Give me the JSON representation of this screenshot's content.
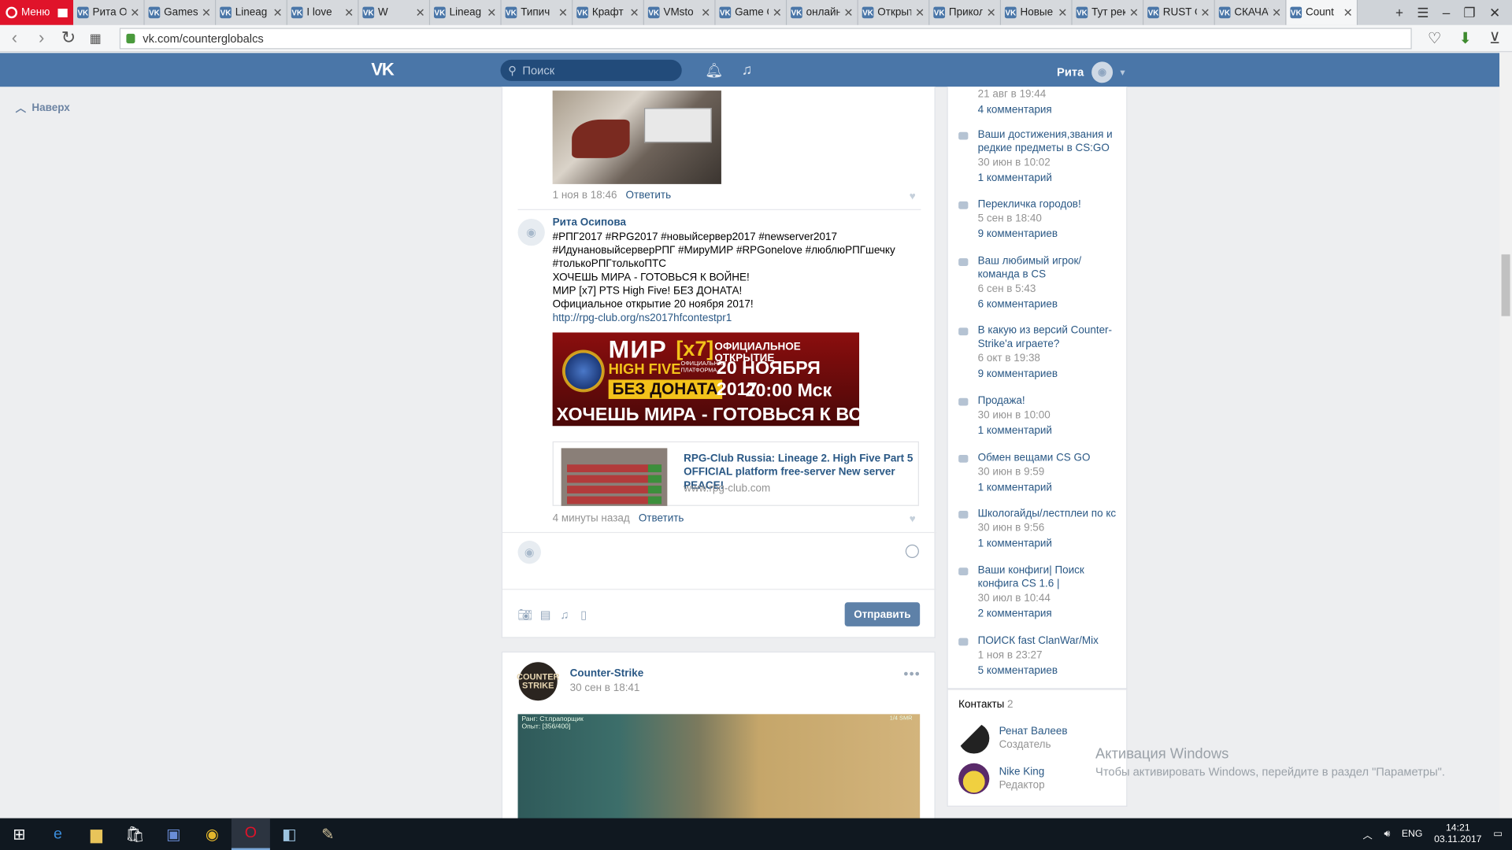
{
  "browser": {
    "menu_label": "Меню",
    "tabs": [
      {
        "label": "Рита О"
      },
      {
        "label": "Games"
      },
      {
        "label": "Lineag"
      },
      {
        "label": "I love"
      },
      {
        "label": "W"
      },
      {
        "label": "Lineag"
      },
      {
        "label": "Типич"
      },
      {
        "label": "Крафт"
      },
      {
        "label": "VMsto"
      },
      {
        "label": "Game On"
      },
      {
        "label": "онлайн и"
      },
      {
        "label": "Открытия"
      },
      {
        "label": "Приколы"
      },
      {
        "label": "Новые се"
      },
      {
        "label": "Тут рекла"
      },
      {
        "label": "RUST Сер"
      },
      {
        "label": "СКАЧАТЬ"
      },
      {
        "label": "Count"
      }
    ],
    "url": "vk.com/counterglobalcs"
  },
  "vk": {
    "logo": "VK",
    "search_placeholder": "Поиск",
    "user_name": "Рита",
    "back_to_top": "Наверх"
  },
  "comments": {
    "first": {
      "time": "1 ноя в 18:46",
      "reply": "Ответить"
    },
    "second": {
      "author": "Рита Осипова",
      "lines": [
        "#РПГ2017 #RPG2017 #новыйсервер2017 #newserver2017",
        "#ИдунановыйсерверРПГ #МируМИР #RPGonelove #люблюРПГшечку",
        "#толькоРПГтолькоПТС",
        "ХОЧЕШЬ МИРА - ГОТОВЬСЯ К ВОЙНЕ!",
        "МИР [x7] PTS High Five! БЕЗ ДОНАТА!",
        "Официальное открытие 20 ноября 2017!"
      ],
      "link": "http://rpg-club.org/ns2017hfcontestpr1",
      "banner": {
        "mir": "МИР",
        "x7": "[x7]",
        "high_five": "HIGH FIVE",
        "sub": "ОФИЦИАЛЬНАЯ ПЛАТФОРМА",
        "no_donate": "БЕЗ ДОНАТА",
        "official": "ОФИЦИАЛЬНОЕ ОТКРЫТИЕ",
        "date": "20 НОЯБРЯ 2017",
        "time": "20:00 Мск",
        "war": "ХОЧЕШЬ МИРА - ГОТОВЬСЯ К ВОЙНЕ"
      },
      "card": {
        "title": "RPG-Club Russia: Lineage 2. High Five Part 5 OFFICIAL platform free-server New server PEACE!",
        "domain": "www.rpg-club.com"
      },
      "time": "4 минуты назад",
      "reply": "Ответить"
    },
    "send_button": "Отправить"
  },
  "post": {
    "author": "Counter-Strike",
    "date": "30 сен в 18:41",
    "logo_text": "COUNTER STRIKE",
    "hud_left": "Ранг: Ст.прапорщик\nОпыт: [356/400]",
    "hud_right": "1/4 SMR"
  },
  "sidebar": {
    "top_partial": {
      "date": "21 авг в 19:44",
      "count": "4 комментария"
    },
    "topics": [
      {
        "title": "Ваши достижения,звания и редкие предметы в CS:GO",
        "date": "30 июн в 10:02",
        "count": "1 комментарий"
      },
      {
        "title": "Перекличка городов!",
        "date": "5 сен в 18:40",
        "count": "9 комментариев"
      },
      {
        "title": "Ваш любимый игрок/ команда в CS",
        "date": "6 сен в 5:43",
        "count": "6 комментариев"
      },
      {
        "title": "В какую из версий Counter-Strike'а играете?",
        "date": "6 окт в 19:38",
        "count": "9 комментариев"
      },
      {
        "title": "Продажа!",
        "date": "30 июн в 10:00",
        "count": "1 комментарий"
      },
      {
        "title": "Обмен вещами CS GO",
        "date": "30 июн в 9:59",
        "count": "1 комментарий"
      },
      {
        "title": "Школогайды/лестплеи по кс",
        "date": "30 июн в 9:56",
        "count": "1 комментарий"
      },
      {
        "title": "Ваши конфиги| Поиск конфига CS 1.6 |",
        "date": "30 июл в 10:44",
        "count": "2 комментария"
      },
      {
        "title": "ПОИСК fast ClanWar/Mix",
        "date": "1 ноя в 23:27",
        "count": "5 комментариев"
      }
    ],
    "contacts_label": "Контакты",
    "contacts_count": "2",
    "contacts": [
      {
        "name": "Ренат Валеев",
        "role": "Создатель"
      },
      {
        "name": "Nike King",
        "role": "Редактор"
      }
    ]
  },
  "watermark": {
    "line1": "Активация Windows",
    "line2": "Чтобы активировать Windows, перейдите в раздел \"Параметры\"."
  },
  "taskbar": {
    "lang": "ENG",
    "time": "14:21",
    "date": "03.11.2017"
  }
}
